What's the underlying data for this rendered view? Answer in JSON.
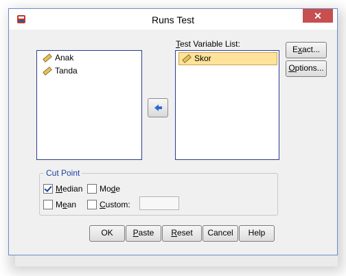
{
  "window": {
    "title": "Runs Test",
    "close_glyph": "✕"
  },
  "source_list": {
    "items": [
      {
        "label": "Anak",
        "icon": "ruler-scale-icon"
      },
      {
        "label": "Tanda",
        "icon": "ruler-scale-icon"
      }
    ]
  },
  "target": {
    "label_pre": "",
    "label_u": "T",
    "label_post": "est Variable List:",
    "items": [
      {
        "label": "Skor",
        "icon": "ruler-scale-icon",
        "selected": true
      }
    ]
  },
  "side_buttons": {
    "exact": {
      "pre": "E",
      "u": "x",
      "post": "act..."
    },
    "options": {
      "pre": "",
      "u": "O",
      "post": "ptions..."
    }
  },
  "cut_point": {
    "legend": "Cut Point",
    "median": {
      "pre": "",
      "u": "M",
      "post": "edian",
      "checked": true
    },
    "mode": {
      "pre": "Mo",
      "u": "d",
      "post": "e",
      "checked": false
    },
    "mean": {
      "pre": "M",
      "u": "e",
      "post": "an",
      "checked": false
    },
    "custom": {
      "pre": "",
      "u": "C",
      "post": "ustom:",
      "checked": false,
      "value": ""
    }
  },
  "bottom_buttons": {
    "ok": "OK",
    "paste": {
      "pre": "",
      "u": "P",
      "post": "aste"
    },
    "reset": {
      "pre": "",
      "u": "R",
      "post": "eset"
    },
    "cancel": "Cancel",
    "help": "Help"
  },
  "colors": {
    "accent": "#1a3fa0",
    "close": "#c74f50",
    "selection": "#ffe39a"
  }
}
